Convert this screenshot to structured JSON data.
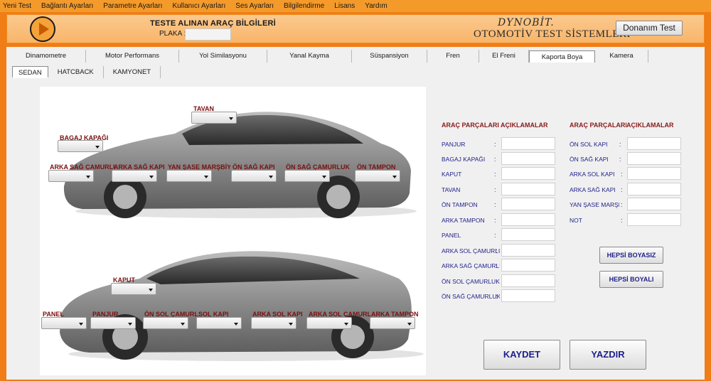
{
  "menu": [
    "Yeni Test",
    "Bağlantı Ayarları",
    "Parametre Ayarları",
    "Kullanıcı Ayarları",
    "Ses Ayarları",
    "Bilgilendirme",
    "Lisans",
    "Yardım"
  ],
  "header": {
    "title": "TESTE ALINAN ARAÇ BİLGİLERİ",
    "plaka_label": "PLAKA :",
    "plaka_value": "",
    "brand": "DYNOBİT.",
    "brand_sub": "OTOMOTİV TEST SİSTEMLERİ",
    "donanim_button": "Donanım Test"
  },
  "tabs": [
    "Dinamometre",
    "Motor Performans",
    "Yol Similasyonu",
    "Yanal Kayma",
    "Süspansiyon",
    "Fren",
    "El Freni",
    "Kaporta Boya",
    "Kamera"
  ],
  "active_tab": "Kaporta Boya",
  "subtabs": [
    "SEDAN",
    "HATCBACK",
    "KAMYONET"
  ],
  "active_subtab": "SEDAN",
  "car_top_labels": [
    "TAVAN",
    "BAGAJ KAPAĞI",
    "ARKA SAĞ ÇAMURLUK",
    "ARKA SAĞ KAPI",
    "YAN ŞASE MARŞBİYEL",
    "ÖN SAĞ KAPI",
    "ÖN SAĞ ÇAMURLUK",
    "ÖN TAMPON"
  ],
  "car_bottom_labels": [
    "KAPUT",
    "PANEL",
    "PANJUR",
    "ÖN SOL ÇAMURLUK",
    "SOL KAPI",
    "ARKA SOL KAPI",
    "ARKA SOL ÇAMURLUK",
    "ARKA TAMPON"
  ],
  "table_left": {
    "header_part": "ARAÇ PARÇALARI",
    "header_desc": "AÇIKLAMALAR",
    "rows": [
      {
        "label": "PANJUR",
        "value": ""
      },
      {
        "label": "BAGAJ KAPAĞI",
        "value": ""
      },
      {
        "label": "KAPUT",
        "value": ""
      },
      {
        "label": "TAVAN",
        "value": ""
      },
      {
        "label": "ÖN TAMPON",
        "value": ""
      },
      {
        "label": "ARKA TAMPON",
        "value": ""
      },
      {
        "label": "PANEL",
        "value": ""
      },
      {
        "label": "ARKA SOL ÇAMURLUK",
        "value": ""
      },
      {
        "label": "ARKA SAĞ ÇAMURLUK",
        "value": ""
      },
      {
        "label": "ÖN SOL ÇAMURLUK",
        "value": ""
      },
      {
        "label": "ÖN SAĞ ÇAMURLUK",
        "value": ""
      }
    ]
  },
  "table_right": {
    "header_part": "ARAÇ PARÇALARI",
    "header_desc": "AÇIKLAMALAR",
    "rows": [
      {
        "label": "ÖN SOL KAPI",
        "value": ""
      },
      {
        "label": "ÖN SAĞ KAPI",
        "value": ""
      },
      {
        "label": "ARKA SOL KAPI",
        "value": ""
      },
      {
        "label": "ARKA SAĞ KAPI",
        "value": ""
      },
      {
        "label": "YAN ŞASE MARŞBİYEL",
        "value": ""
      },
      {
        "label": "NOT",
        "value": ""
      }
    ]
  },
  "buttons": {
    "hepsi_boyasiz": "HEPSİ BOYASIZ",
    "hepsi_boyali": "HEPSİ BOYALI",
    "kaydet": "KAYDET",
    "yazdir": "YAZDIR"
  },
  "colors": {
    "accent_orange": "#f07d16",
    "label_red": "#7a1010",
    "label_blue": "#1f1f8a"
  }
}
